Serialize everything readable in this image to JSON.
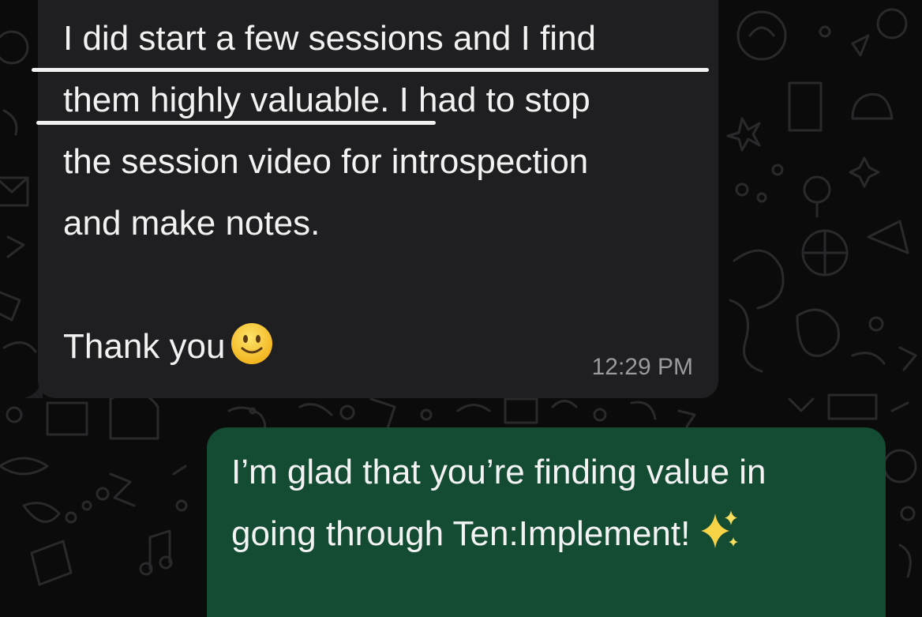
{
  "incoming_message": {
    "lines": [
      "I did start a few sessions and I find",
      "them highly valuable. I had to stop",
      "the session video for introspection",
      "and make notes.",
      "Thank you"
    ],
    "emoji": "slightly-smiling-face",
    "timestamp": "12:29 PM"
  },
  "outgoing_message": {
    "lines": [
      "I’m glad that you’re finding value in",
      "going through Ten:Implement!"
    ],
    "emoji": "sparkles"
  },
  "colors": {
    "background": "#0b0b0c",
    "incoming_bubble": "#1f1f21",
    "outgoing_bubble": "#144b33",
    "text": "#f2f2f2",
    "timestamp": "#9b9b9f",
    "emoji_face": "#f7c528"
  }
}
